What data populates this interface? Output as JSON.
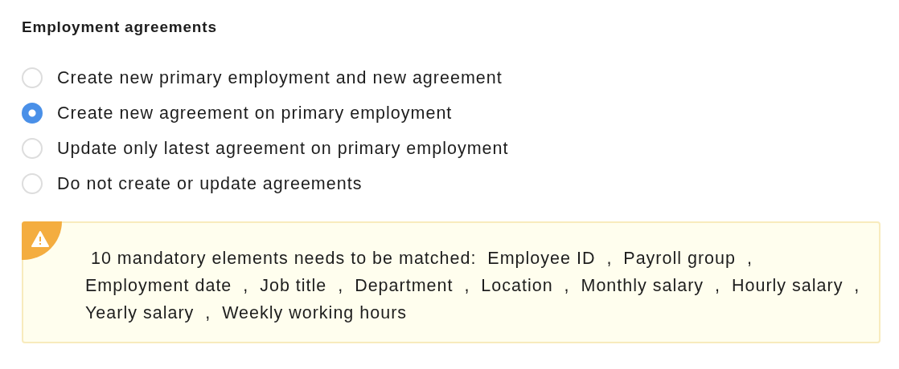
{
  "section": {
    "title": "Employment agreements"
  },
  "options": [
    {
      "label": "Create new primary employment and new agreement",
      "selected": false
    },
    {
      "label": "Create new agreement on primary employment",
      "selected": true
    },
    {
      "label": "Update only latest agreement on primary employment",
      "selected": false
    },
    {
      "label": "Do not create or update agreements",
      "selected": false
    }
  ],
  "warning": {
    "text": " 10 mandatory elements needs to be matched:  Employee ID  ,  Payroll group  ,  Employment date  ,  Job title  ,  Department  ,  Location  ,  Monthly salary  ,  Hourly salary  ,  Yearly salary  ,  Weekly working hours"
  }
}
